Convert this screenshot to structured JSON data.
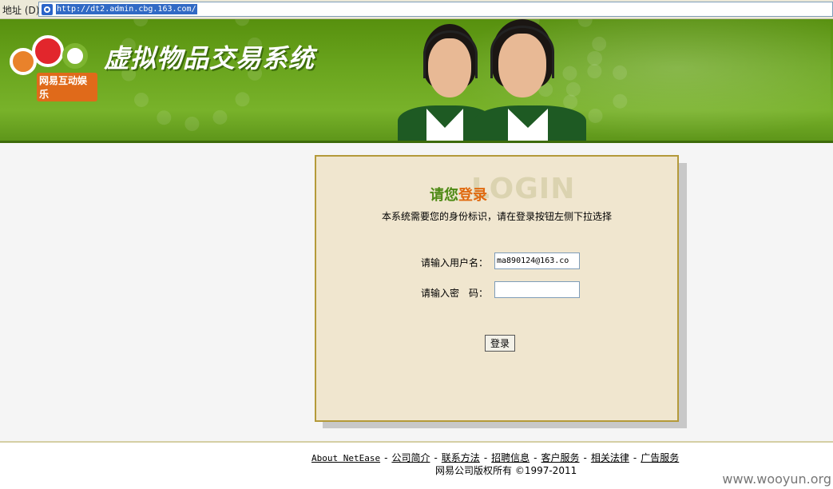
{
  "browser": {
    "address_label": "地址 (D)",
    "url": "http://dt2.admin.cbg.163.com/"
  },
  "banner": {
    "logo_text": "网易互动娱乐",
    "title": "虚拟物品交易系统"
  },
  "login": {
    "watermark": "LOGIN",
    "heading_part1": "请您",
    "heading_part2": "登录",
    "description": "本系统需要您的身份标识，请在登录按钮左侧下拉选择",
    "username_label": "请输入用户名：",
    "username_value": "ma890124@163.co",
    "password_label": "请输入密　码：",
    "password_value": "",
    "submit_label": "登录"
  },
  "footer": {
    "links": [
      "About NetEase",
      "公司简介",
      "联系方法",
      "招聘信息",
      "客户服务",
      "相关法律",
      "广告服务"
    ],
    "separator": "-",
    "copyright": "网易公司版权所有 ©1997-2011"
  },
  "site_watermark": "www.wooyun.org",
  "colors": {
    "banner_green": "#6aa51e",
    "panel_bg": "#f0e6cf",
    "panel_border": "#b49a3a",
    "heading_green": "#4e8a15",
    "heading_orange": "#e06a10"
  }
}
